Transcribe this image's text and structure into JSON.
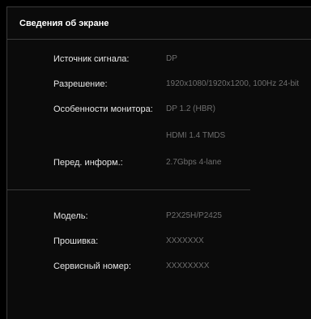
{
  "panel": {
    "title": "Сведения об экране"
  },
  "info": [
    {
      "label": "Источник сигнала:",
      "value": "DP"
    },
    {
      "label": "Разрешение:",
      "value": "1920x1080/1920x1200, 100Hz 24-bit"
    },
    {
      "label": "Особенности монитора:",
      "value": "DP 1.2 (HBR)"
    },
    {
      "label": "",
      "value": "HDMI 1.4 TMDS"
    },
    {
      "label": "Перед. информ.:",
      "value": "2.7Gbps 4-lane"
    }
  ],
  "device": [
    {
      "label": "Модель:",
      "value": "P2X25H/P2425"
    },
    {
      "label": "Прошивка:",
      "value": "XXXXXXX"
    },
    {
      "label": "Сервисный номер:",
      "value": "XXXXXXXX"
    }
  ],
  "colors": {
    "background": "#000000",
    "panel": "#0b0b0b",
    "label": "#e6e6e6",
    "value": "#6f6f6f",
    "border": "#3a3a3a"
  }
}
